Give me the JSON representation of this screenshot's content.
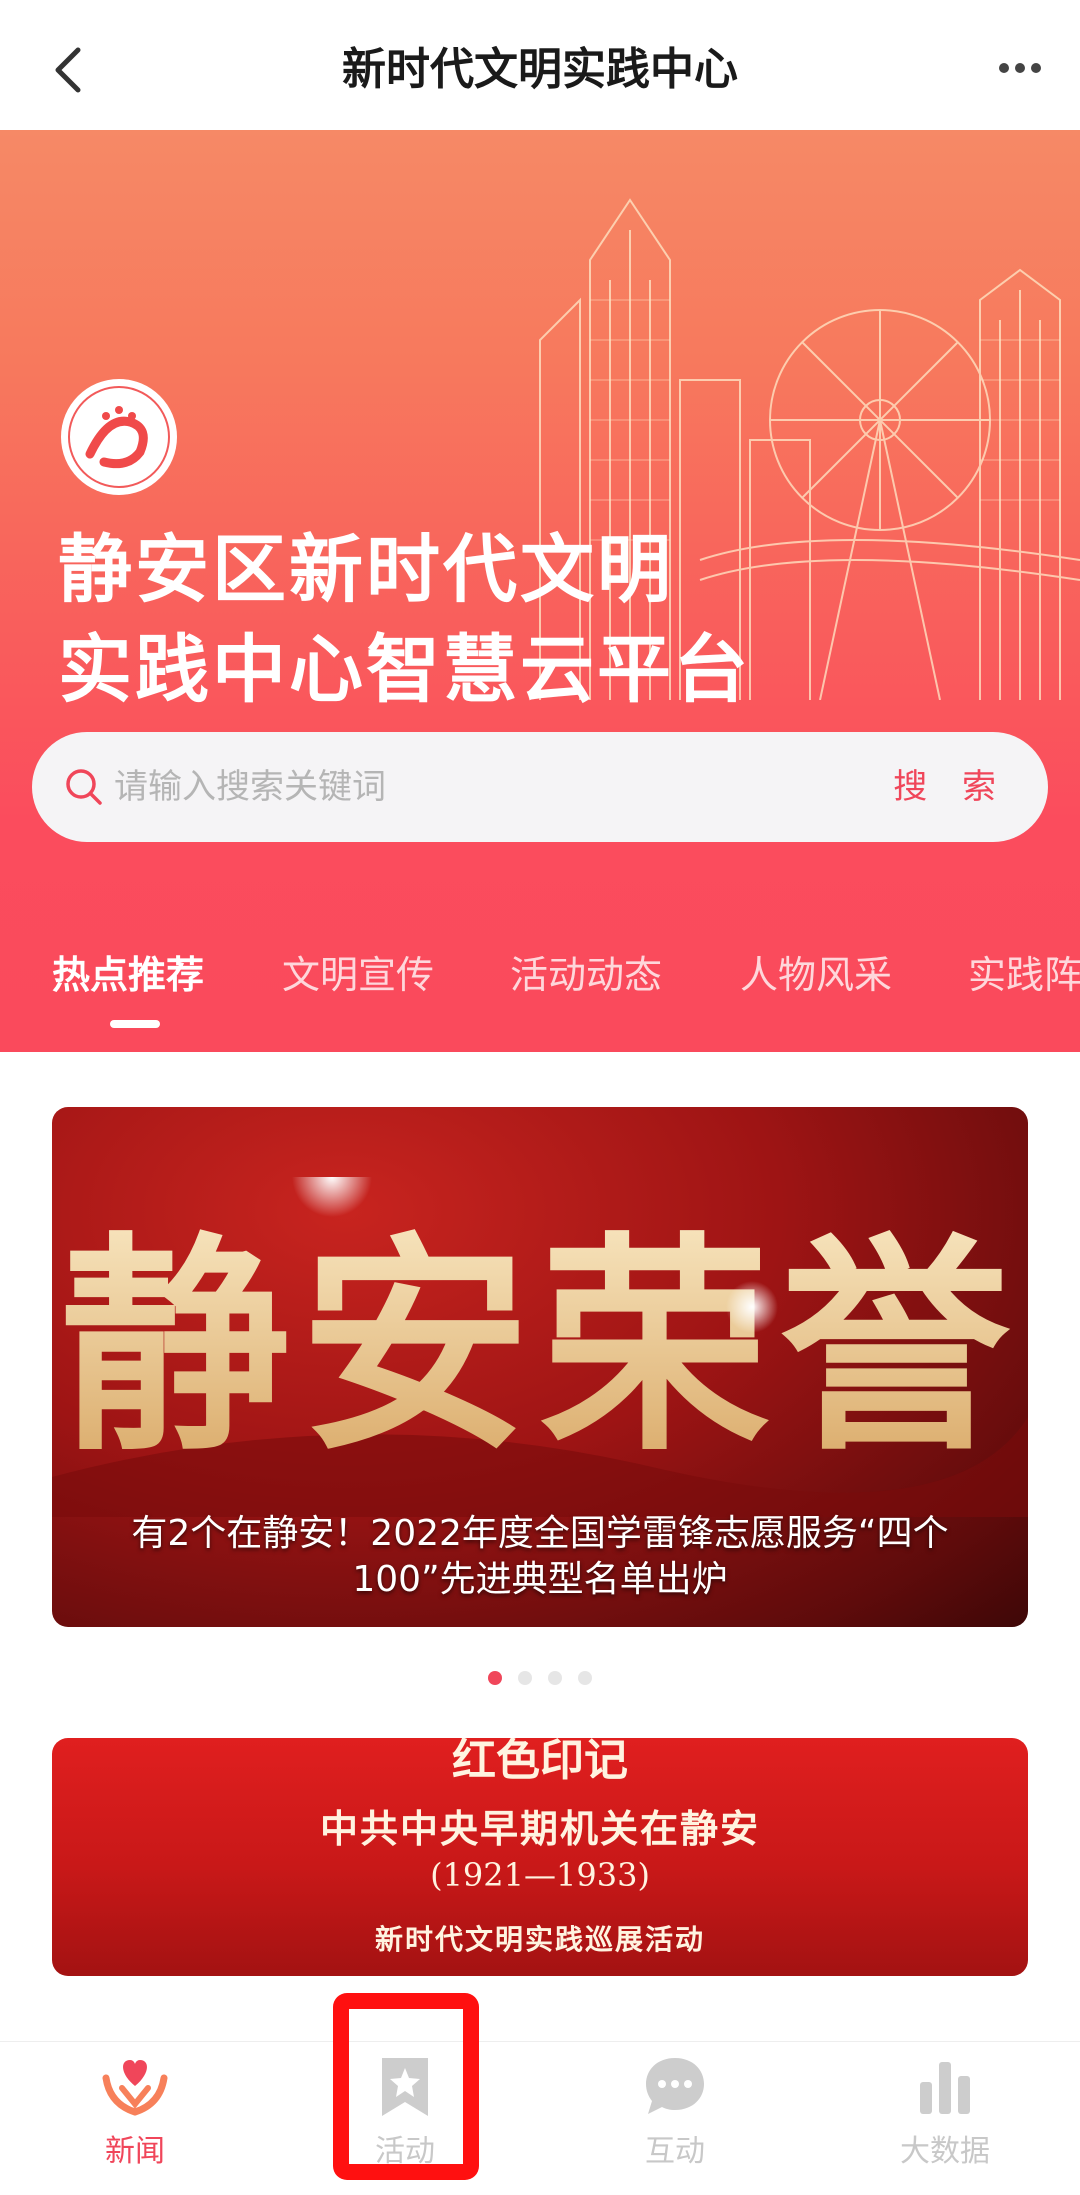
{
  "nav": {
    "title": "新时代文明实践中心",
    "back_icon": "back-arrow-icon",
    "more_icon": "more-dots-icon"
  },
  "banner": {
    "title_line1": "静安区新时代文明",
    "title_line2": "实践中心智慧云平台",
    "search": {
      "placeholder": "请输入搜索关键词",
      "button_label": "搜 索"
    },
    "tabs": [
      "热点推荐",
      "文明宣传",
      "活动动态",
      "人物风采",
      "实践阵"
    ],
    "active_tab": 0
  },
  "carousel": {
    "image_text": "静安荣誉",
    "caption": "有2个在静安！2022年度全国学雷锋志愿服务“四个100”先进典型名单出炉",
    "dot_count": 4,
    "active_dot": 0
  },
  "card2": {
    "top_text": "红色印记",
    "main_text": "中共中央早期机关在静安",
    "years": "(1921—1933)",
    "sub_text": "新时代文明实践巡展活动"
  },
  "tabbar": {
    "items": [
      {
        "label": "新闻",
        "icon": "heart-hands-icon",
        "active": true
      },
      {
        "label": "活动",
        "icon": "bookmark-star-icon",
        "active": false
      },
      {
        "label": "互动",
        "icon": "chat-bubble-icon",
        "active": false
      },
      {
        "label": "大数据",
        "icon": "bar-chart-icon",
        "active": false
      }
    ]
  },
  "colors": {
    "accent": "#f0465a",
    "banner_top": "#f68966",
    "banner_bottom": "#fa4a5c",
    "highlight": "#ff1010"
  }
}
